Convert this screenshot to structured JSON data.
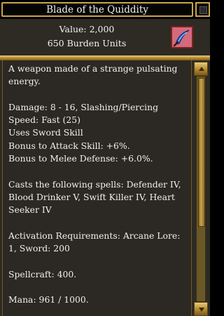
{
  "window": {
    "title": "Blade of the Quiddity"
  },
  "header": {
    "value": "Value: 2,000",
    "burden": "650 Burden Units",
    "item_icon": "curved-blade-icon"
  },
  "description": {
    "intro": "A weapon made of a strange pulsating energy.",
    "stats": [
      "Damage: 8 - 16, Slashing/Piercing",
      "Speed: Fast (25)",
      "Uses Sword Skill",
      "Bonus to Attack Skill: +6%.",
      "Bonus to Melee Defense: +6.0%."
    ],
    "spells": "Casts the following spells: Defender IV, Blood Drinker V, Swift Killer IV, Heart Seeker IV",
    "activation": "Activation Requirements: Arcane Lore: 1, Sword: 200",
    "spellcraft": "Spellcraft: 400.",
    "mana": "Mana: 961 / 1000."
  },
  "scroll": {
    "visible_fraction": 0.67
  }
}
